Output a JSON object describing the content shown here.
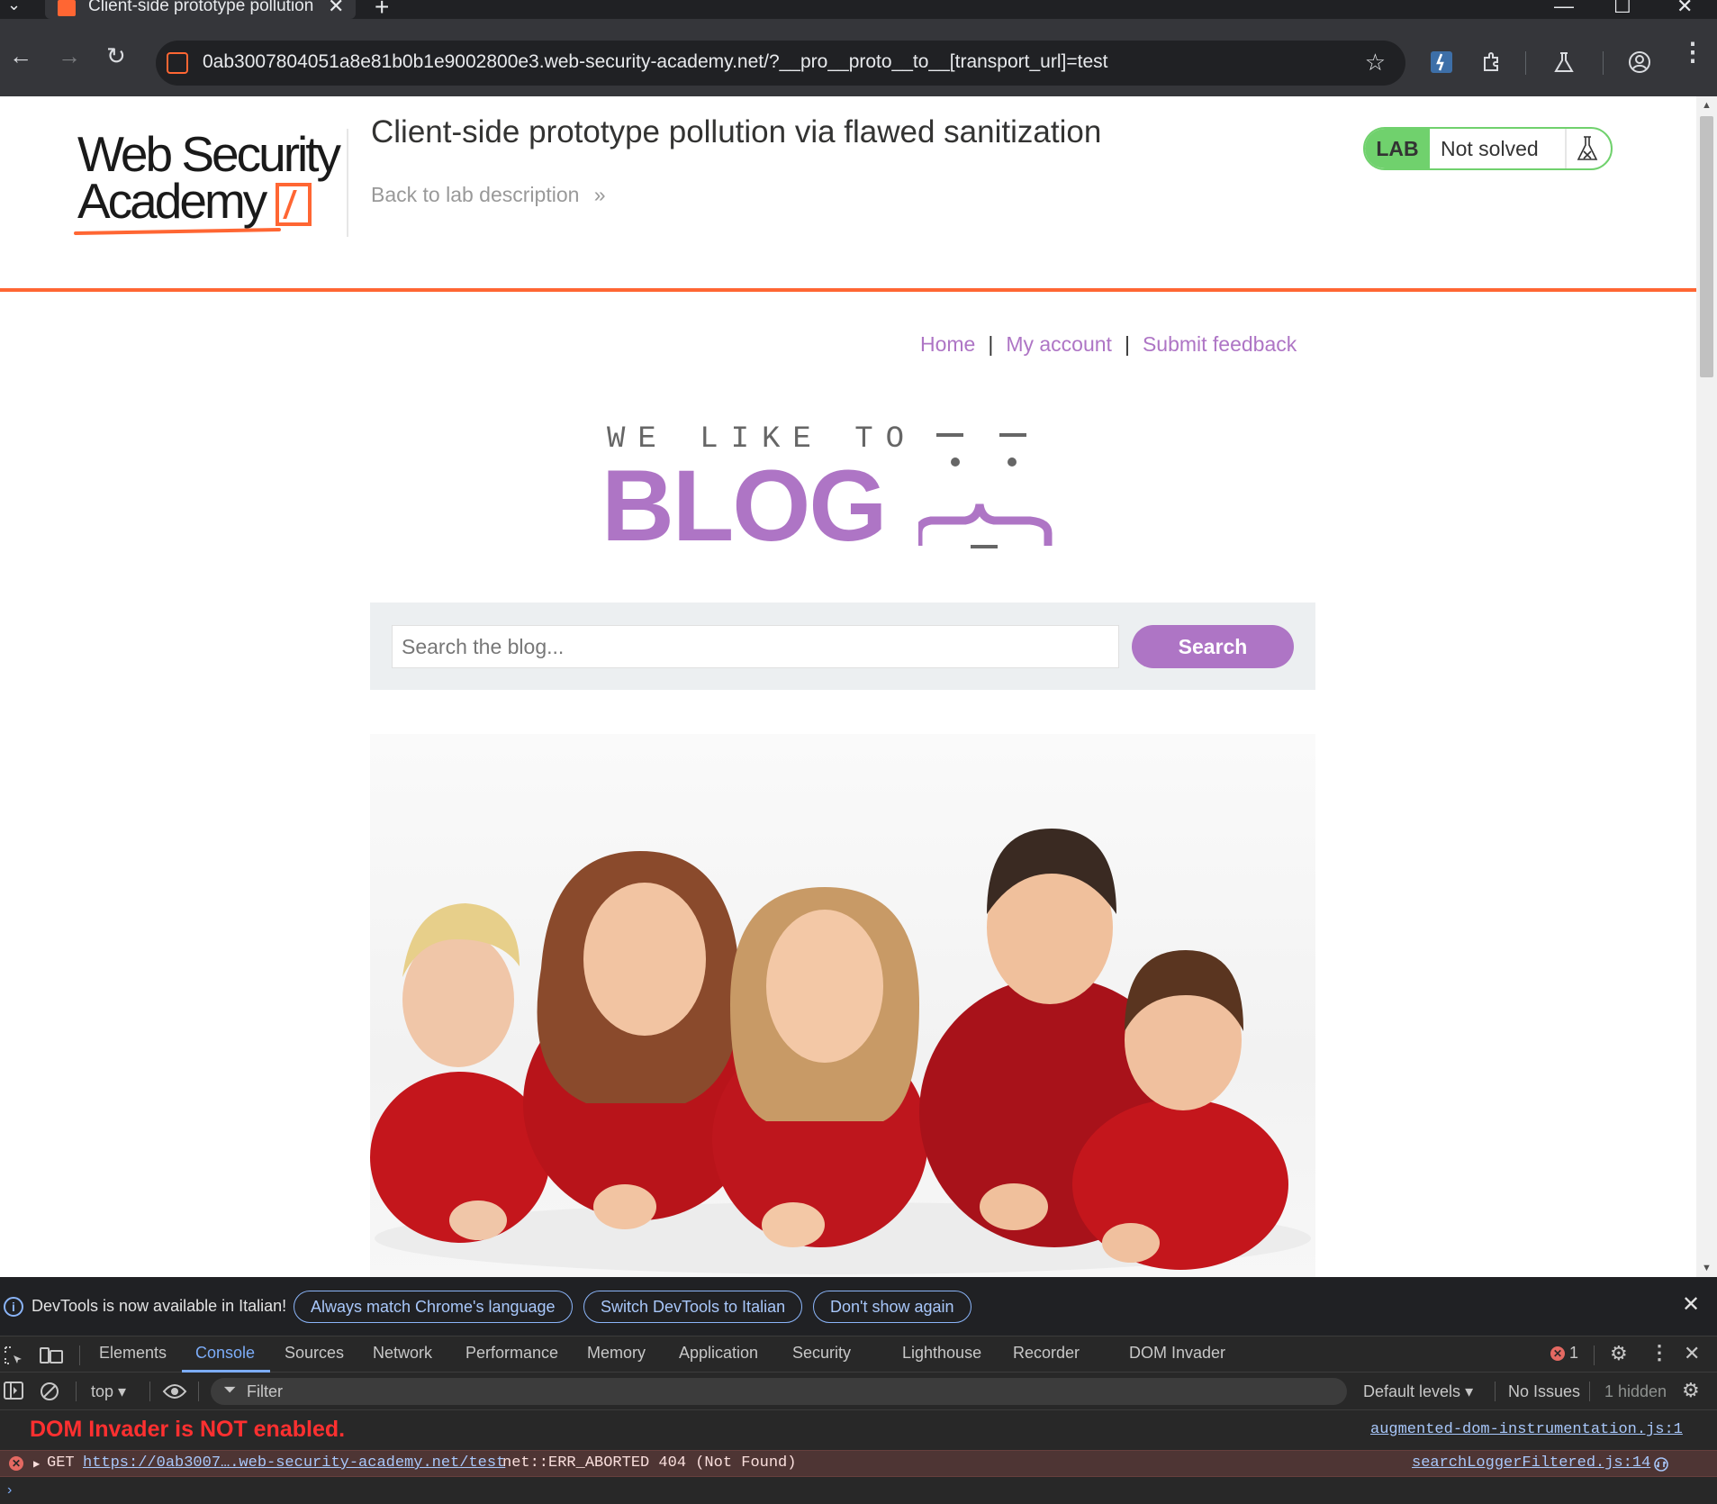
{
  "browser": {
    "tab_title": "Client-side prototype pollution via flawed sanitization",
    "tab_close": "✕",
    "new_tab": "+",
    "url": "0ab3007804051a8e81b0b1e9002800e3.web-security-academy.net/?__pro__proto__to__[transport_url]=test",
    "window_controls": [
      "—",
      "☐",
      "✕"
    ]
  },
  "academy": {
    "logo_line1": "Web Security",
    "logo_line2": "Academy",
    "lab_title": "Client-side prototype pollution via flawed sanitization",
    "back_link": "Back to lab description",
    "back_arrows": "»",
    "lab_badge_label": "LAB",
    "lab_status": "Not solved",
    "brand_color": "#ff6633",
    "solved_color": "#70d16d"
  },
  "blog": {
    "nav": {
      "home": "Home",
      "my_account": "My account",
      "submit_feedback": "Submit feedback",
      "separator": "|"
    },
    "logo_top": "WE LIKE TO",
    "logo_main": "BLOG",
    "accent_color": "#ae75c5",
    "search": {
      "placeholder": "Search the blog...",
      "button_label": "Search"
    }
  },
  "devtools": {
    "infobar": {
      "message": "DevTools is now available in Italian!",
      "btn_match": "Always match Chrome's language",
      "btn_switch": "Switch DevTools to Italian",
      "btn_dont_show": "Don't show again"
    },
    "tabs": [
      "Elements",
      "Console",
      "Sources",
      "Network",
      "Performance",
      "Memory",
      "Application",
      "Security",
      "Lighthouse",
      "Recorder",
      "DOM Invader"
    ],
    "active_tab": "Console",
    "error_count": "1",
    "filterbar": {
      "context": "top",
      "filter_placeholder": "Filter",
      "levels": "Default levels",
      "issues": "No Issues",
      "hidden": "1 hidden"
    },
    "console": {
      "line1_text": "DOM Invader is NOT enabled.",
      "line1_source": "augmented-dom-instrumentation.js:1",
      "line2_method": "GET",
      "line2_url": "https://0ab3007….web-security-academy.net/test",
      "line2_error": "net::ERR_ABORTED 404 (Not Found)",
      "line2_source": "searchLoggerFiltered.js:14"
    }
  }
}
